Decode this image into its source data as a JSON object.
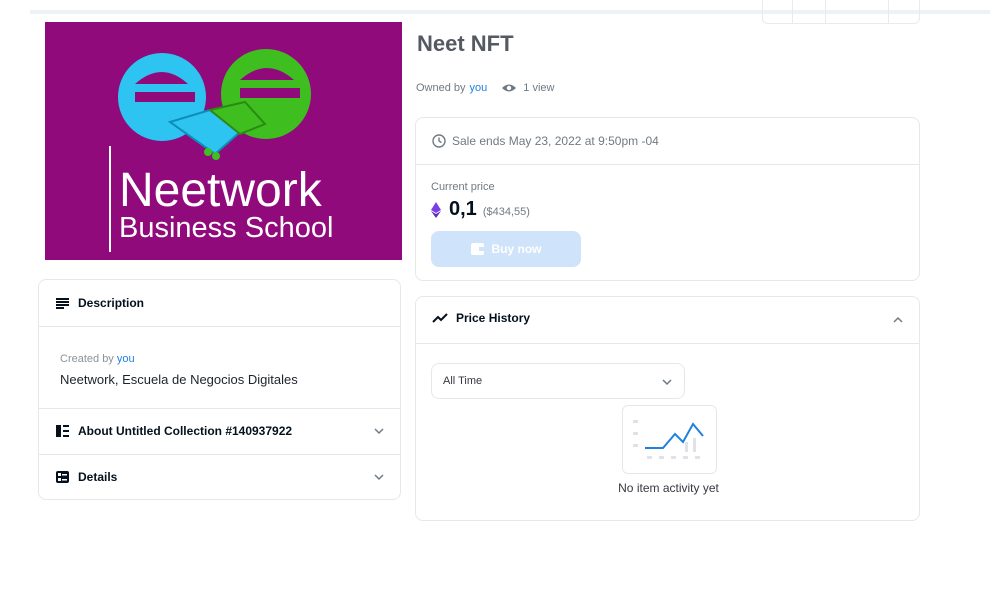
{
  "nft": {
    "title": "Neet NFT",
    "owned_by_prefix": "Owned by",
    "owner": "you",
    "views": "1 view",
    "image": {
      "brand_line1": "Neetwork",
      "brand_line2": "Business School",
      "background_color": "#900a7b"
    }
  },
  "description": {
    "header": "Description",
    "created_by_prefix": "Created by",
    "creator": "you",
    "text": "Neetwork, Escuela de Negocios Digitales"
  },
  "about": {
    "header": "About Untitled Collection #140937922"
  },
  "details": {
    "header": "Details"
  },
  "sale": {
    "ends": "Sale ends May 23, 2022 at 9:50pm -04",
    "current_price_label": "Current price",
    "price_eth": "0,1",
    "price_usd": "($434,55)",
    "buy_label": "Buy now"
  },
  "history": {
    "header": "Price History",
    "filter_value": "All Time",
    "empty_text": "No item activity yet"
  },
  "colors": {
    "link": "#2081e2",
    "logo_blue": "#2ec4f1",
    "logo_green": "#3fbf1f",
    "eth_purple": "#7b3fe4"
  }
}
